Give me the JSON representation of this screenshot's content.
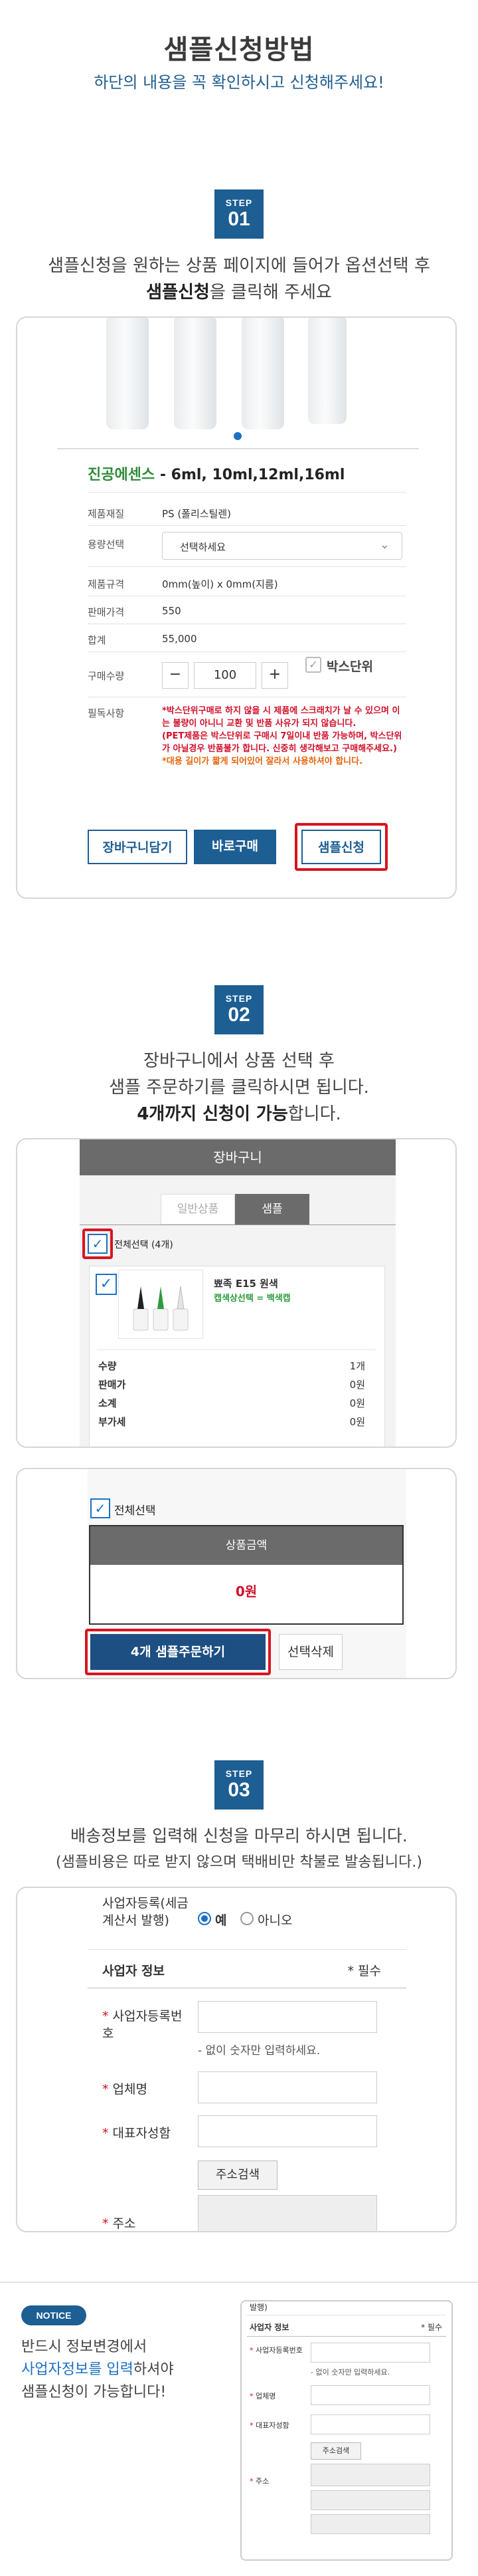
{
  "header": {
    "title": "샘플신청방법",
    "subtitle": "하단의 내용을 꼭 확인하시고 신청해주세요!"
  },
  "step1": {
    "badge_label": "STEP",
    "badge_number": "01",
    "desc_line1": "샘플신청을 원하는 상품 페이지에 들어가 옵션선택 후",
    "desc_bold": "샘플신청",
    "desc_line2_rest": "을 클릭해 주세요",
    "product": {
      "name_green": "진공에센스",
      "name_rest": " - 6ml, 10ml,12ml,16ml",
      "rows": [
        {
          "label": "제품재질",
          "value": "PS (폴리스틸렌)"
        },
        {
          "label": "용량선택",
          "value": "선택하세요"
        },
        {
          "label": "제품규격",
          "value": "0mm(높이) x 0mm(지름)"
        },
        {
          "label": "판매가격",
          "value": "550"
        },
        {
          "label": "합계",
          "value": "55,000"
        },
        {
          "label": "구매수량",
          "value": "100"
        },
        {
          "label": "필독사항",
          "value": ""
        }
      ],
      "minus": "−",
      "plus": "+",
      "box_unit": "박스단위",
      "notice_red": "*박스단위구매로 하지 않을 시 제품에 스크래치가 날 수 있으며 이는 불량이 아니니 교환 및 반품 사유가 되지 않습니다.",
      "notice_red2": "(PET제품은 박스단위로 구매시 7일이내 반품 가능하며, 박스단위가 아닐경우 반품불가 합니다. 신중히 생각해보고 구매해주세요.)",
      "notice_orange": "*대용 길이가 짧게 되어있어 잘라서 사용하셔야 합니다.",
      "btn_cart": "장바구니담기",
      "btn_buy": "바로구매",
      "btn_sample": "샘플신청"
    }
  },
  "step2": {
    "badge_label": "STEP",
    "badge_number": "02",
    "desc_line1": "장바구니에서 상품 선택 후",
    "desc_line2": "샘플 주문하기를 클릭하시면 됩니다.",
    "desc_bold": "4개까지 신청이 가능",
    "desc_line3_rest": "합니다.",
    "cart": {
      "header": "장바구니",
      "tab_general": "일반상품",
      "tab_sample": "샘플",
      "select_all": "전체선택 (4개)",
      "item_name": "뾰족 E15 원색",
      "item_option": "캡색상선택 = 백색캡",
      "rows": [
        {
          "label": "수량",
          "value": "1개"
        },
        {
          "label": "판매가",
          "value": "0원"
        },
        {
          "label": "소계",
          "value": "0원"
        },
        {
          "label": "부가세",
          "value": "0원"
        }
      ]
    },
    "order": {
      "select_all": "전체선택",
      "amount_label": "상품금액",
      "amount_value": "0원",
      "btn_order": "4개 샘플주문하기",
      "btn_delete": "선택삭제"
    }
  },
  "step3": {
    "badge_label": "STEP",
    "badge_number": "03",
    "desc_line1": "배송정보를 입력해 신청을 마무리 하시면 됩니다.",
    "desc_line2": "(샘플비용은 따로 받지 않으며 택배비만 착불로 발송됩니다.)",
    "form": {
      "biz_reg_label": "사업자등록(세금계산서 발행)",
      "radio_yes": "예",
      "radio_no": "아니오",
      "section_title": "사업자 정보",
      "required_note": "* 필수",
      "field_bizno": "사업자등록번호",
      "bizno_hint": "- 없이 숫자만 입력하세요.",
      "field_company": "업체명",
      "field_ceo": "대표자성함",
      "btn_address": "주소검색",
      "field_address": "주소"
    }
  },
  "notice": {
    "badge": "NOTICE",
    "line1": "반드시 정보변경에서",
    "line2_blue": "사업자정보를 입력",
    "line2_rest": "하셔야",
    "line3": "샘플신청이 가능합니다!",
    "mini": {
      "top": "발행)",
      "section_title": "사업자 정보",
      "required_note": "* 필수",
      "field_bizno": "사업자등록번호",
      "bizno_hint": "- 없이 숫자만 입력하세요.",
      "field_company": "업체명",
      "field_ceo": "대표자성함",
      "btn_address": "주소검색",
      "field_address": "주소"
    }
  },
  "colors": {
    "accent": "#1d5e93",
    "red": "#d7141f",
    "green": "#2e8b3a"
  }
}
